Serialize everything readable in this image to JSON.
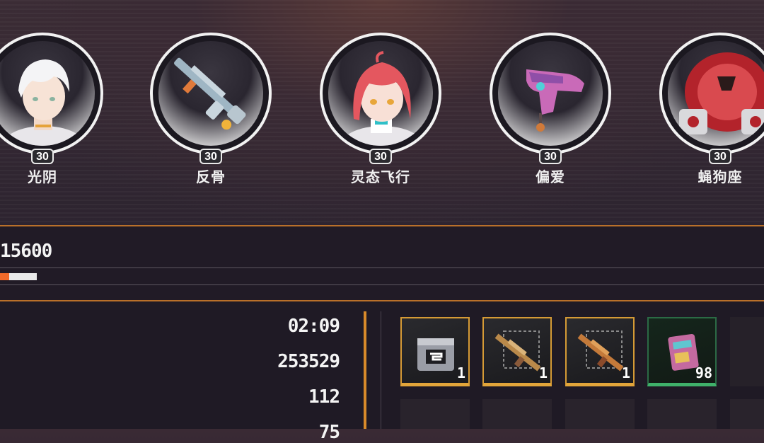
{
  "team": [
    {
      "name": "光阴",
      "level": "30",
      "icon": "character-white-hair-portrait"
    },
    {
      "name": "反骨",
      "level": "30",
      "icon": "rifle-weapon-icon"
    },
    {
      "name": "灵态飞行",
      "level": "30",
      "icon": "character-pink-hair-portrait"
    },
    {
      "name": "偏爱",
      "level": "30",
      "icon": "pink-pistol-weapon-icon"
    },
    {
      "name": "蝇狗座",
      "level": "30",
      "icon": "red-mech-portrait"
    }
  ],
  "score": "15600",
  "progress_fraction": 0.25,
  "stats": [
    "02:09",
    "253529",
    "112",
    "75"
  ],
  "rewards": [
    {
      "qty": "1",
      "rarity": "gold",
      "icon": "supply-crate-icon"
    },
    {
      "qty": "1",
      "rarity": "gold",
      "icon": "rifle-blueprint-icon"
    },
    {
      "qty": "1",
      "rarity": "gold",
      "icon": "rifle-blueprint-icon"
    },
    {
      "qty": "98",
      "rarity": "green",
      "icon": "data-card-icon"
    }
  ],
  "colors": {
    "accent_orange": "#d88a2a",
    "progress": "#ef6a2a",
    "gold_frame": "#d59a35",
    "green_frame": "#3fb16a"
  }
}
